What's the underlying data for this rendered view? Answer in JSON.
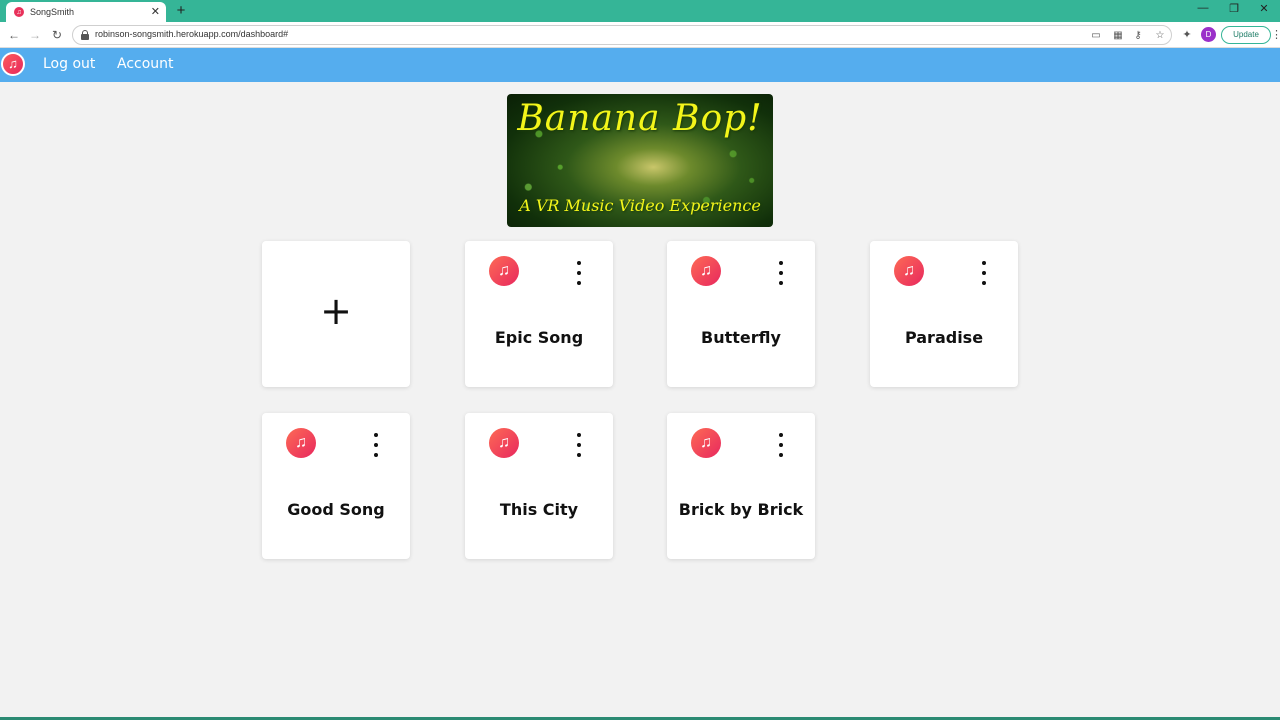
{
  "browser": {
    "tab_title": "SongSmith",
    "tab_close": "✕",
    "new_tab": "+",
    "window_controls": {
      "minimize": "—",
      "restore": "❐",
      "close": "✕"
    },
    "url": "robinson-songsmith.herokuapp.com/dashboard#",
    "profile_initial": "D",
    "update_label": "Update",
    "accent_color": "#35b597"
  },
  "nav": {
    "logout_label": "Log out",
    "account_label": "Account",
    "bar_color": "#55adee"
  },
  "banner": {
    "title": "Banana Bop!",
    "subtitle": "A VR Music Video Experience"
  },
  "add_card": {
    "symbol": "+"
  },
  "songs": [
    {
      "name": "Epic Song"
    },
    {
      "name": "Butterfly"
    },
    {
      "name": "Paradise"
    },
    {
      "name": "Good Song"
    },
    {
      "name": "This City"
    },
    {
      "name": "Brick by Brick"
    }
  ],
  "icons": {
    "song": "music-note-icon",
    "menu": "kebab-menu-icon",
    "logo": "music-note-icon"
  }
}
